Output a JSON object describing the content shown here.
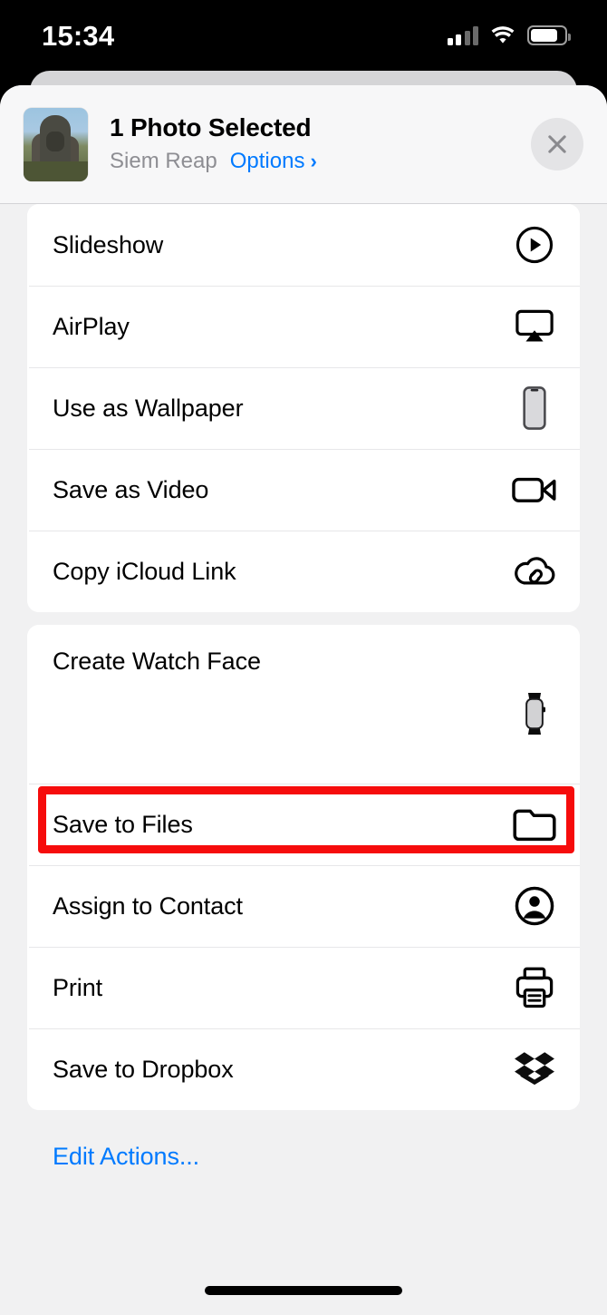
{
  "status_bar": {
    "time": "15:34",
    "cellular_icon": "cellular-bars-icon",
    "cellular_bars_filled": 2,
    "cellular_bars_total": 4,
    "wifi_icon": "wifi-icon",
    "battery_icon": "battery-icon",
    "battery_level_pct": 80
  },
  "share_sheet": {
    "header": {
      "thumbnail_alt": "photo-thumbnail",
      "title": "1 Photo Selected",
      "location": "Siem Reap",
      "options_label": "Options",
      "options_chevron": "›",
      "close_icon": "close-icon"
    },
    "sections": [
      {
        "rows": [
          {
            "label": "Slideshow",
            "icon": "play-circle-icon",
            "highlighted": false
          },
          {
            "label": "AirPlay",
            "icon": "airplay-icon",
            "highlighted": false
          },
          {
            "label": "Use as Wallpaper",
            "icon": "iphone-icon",
            "highlighted": false
          },
          {
            "label": "Save as Video",
            "icon": "video-camera-icon",
            "highlighted": false
          },
          {
            "label": "Copy iCloud Link",
            "icon": "icloud-link-icon",
            "highlighted": false
          }
        ]
      },
      {
        "rows": [
          {
            "label": "Create Watch Face",
            "icon": "apple-watch-icon",
            "highlighted": false,
            "tall": true
          },
          {
            "label": "Save to Files",
            "icon": "folder-icon",
            "highlighted": true
          },
          {
            "label": "Assign to Contact",
            "icon": "contact-circle-icon",
            "highlighted": false
          },
          {
            "label": "Print",
            "icon": "printer-icon",
            "highlighted": false
          },
          {
            "label": "Save to Dropbox",
            "icon": "dropbox-icon",
            "highlighted": false
          }
        ]
      }
    ],
    "edit_actions_label": "Edit Actions..."
  },
  "colors": {
    "accent_blue": "#007AFF",
    "highlight_red": "#F60C0C",
    "secondary_text": "#8E8E93",
    "sheet_background": "#F1F1F2",
    "card_background": "#FFFFFF",
    "status_bar_background": "#000000"
  },
  "home_indicator": "home-indicator"
}
